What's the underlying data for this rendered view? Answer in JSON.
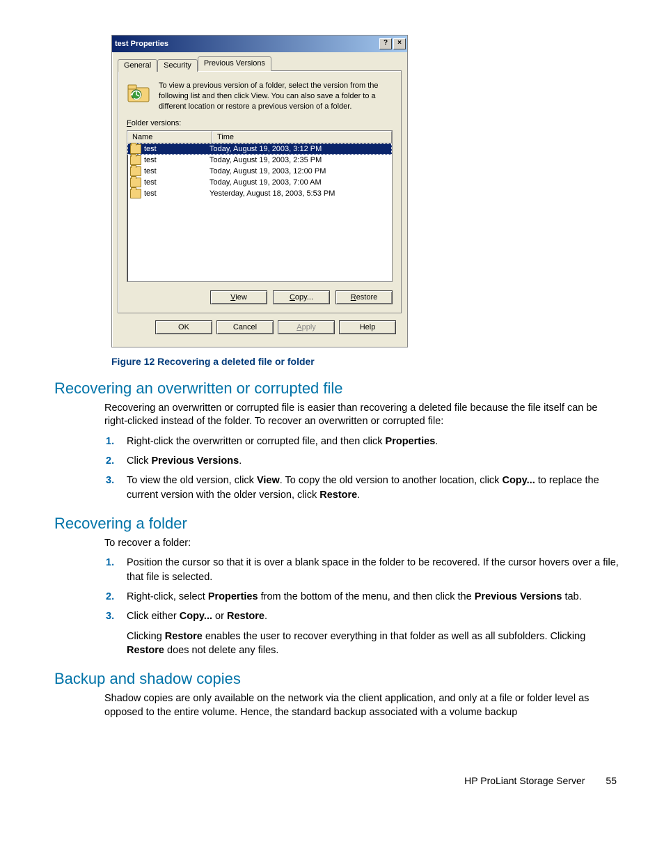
{
  "dialog": {
    "title": "test Properties",
    "help_glyph": "?",
    "close_glyph": "×",
    "tabs": {
      "general": "General",
      "security": "Security",
      "previous": "Previous Versions"
    },
    "intro": "To view a previous version of a folder, select the version from the following list and then click View. You can also save a folder to a different location or restore a previous version of a folder.",
    "folder_versions_label": "Folder versions:",
    "columns": {
      "name": "Name",
      "time": "Time"
    },
    "rows": [
      {
        "name": "test",
        "time": "Today, August 19, 2003, 3:12 PM",
        "selected": true
      },
      {
        "name": "test",
        "time": "Today, August 19, 2003, 2:35 PM",
        "selected": false
      },
      {
        "name": "test",
        "time": "Today, August 19, 2003, 12:00 PM",
        "selected": false
      },
      {
        "name": "test",
        "time": "Today, August 19, 2003, 7:00 AM",
        "selected": false
      },
      {
        "name": "test",
        "time": "Yesterday, August 18, 2003, 5:53 PM",
        "selected": false
      }
    ],
    "buttons": {
      "view": "View",
      "copy": "Copy...",
      "restore": "Restore",
      "ok": "OK",
      "cancel": "Cancel",
      "apply": "Apply",
      "help": "Help"
    }
  },
  "figure_caption": "Figure 12 Recovering a deleted file or folder",
  "section1": {
    "title": "Recovering an overwritten or corrupted file",
    "para": "Recovering an overwritten or corrupted file is easier than recovering a deleted file because the file itself can be right-clicked instead of the folder. To recover an overwritten or corrupted file:",
    "steps": {
      "s1a": "Right-click the overwritten or corrupted file, and then click ",
      "s1b": "Properties",
      "s1c": ".",
      "s2a": "Click ",
      "s2b": "Previous Versions",
      "s2c": ".",
      "s3a": "To view the old version, click ",
      "s3b": "View",
      "s3c": ". To copy the old version to another location, click ",
      "s3d": "Copy...",
      "s3e": " to replace the current version with the older version, click ",
      "s3f": "Restore",
      "s3g": "."
    }
  },
  "section2": {
    "title": "Recovering a folder",
    "para": "To recover a folder:",
    "steps": {
      "s1": "Position the cursor so that it is over a blank space in the folder to be recovered. If the cursor hovers over a file, that file is selected.",
      "s2a": "Right-click, select ",
      "s2b": "Properties",
      "s2c": " from the bottom of the menu, and then click the ",
      "s2d": "Previous Versions",
      "s2e": " tab.",
      "s3a": "Click either ",
      "s3b": "Copy...",
      "s3c": " or ",
      "s3d": "Restore",
      "s3e": "."
    },
    "after1a": "Clicking ",
    "after1b": "Restore",
    "after1c": " enables the user to recover everything in that folder as well as all subfolders. Clicking ",
    "after1d": "Restore",
    "after1e": " does not delete any files."
  },
  "section3": {
    "title": "Backup and shadow copies",
    "para": "Shadow copies are only available on the network via the client application, and only at a file or folder level as opposed to the entire volume. Hence, the standard backup associated with a volume backup"
  },
  "footer": {
    "product": "HP ProLiant Storage Server",
    "page": "55"
  }
}
